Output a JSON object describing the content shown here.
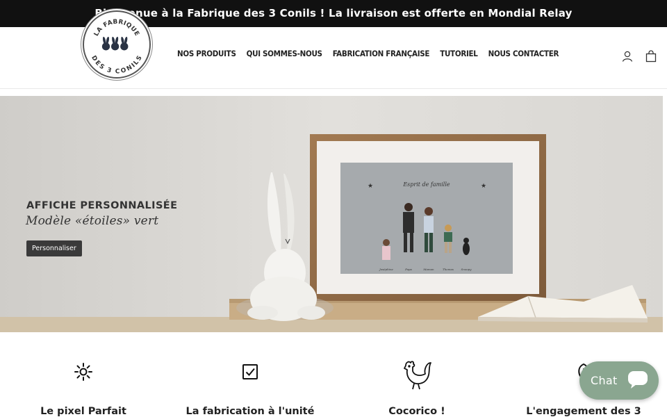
{
  "announcement": {
    "text": "Bienvenue à la Fabrique des 3 Conils ! La livraison est offerte en Mondial Relay"
  },
  "logo": {
    "top_text": "LA FABRIQUE",
    "bottom_text": "DES 3 CONILS"
  },
  "nav": {
    "items": [
      {
        "label": "NOS PRODUITS"
      },
      {
        "label": "QUI SOMMES-NOUS"
      },
      {
        "label": "FABRICATION FRANÇAISE"
      },
      {
        "label": "TUTORIEL"
      },
      {
        "label": "NOUS CONTACTER"
      }
    ]
  },
  "header_icons": {
    "account": "user-icon",
    "cart": "shopping-bag-icon"
  },
  "hero": {
    "title": "AFFICHE PERSONNALISÉE",
    "subtitle": "Modèle «étoiles» vert",
    "button": "Personnaliser",
    "poster_title": "Esprit de famille",
    "poster_names": [
      "Joséphine",
      "Papa",
      "Maman",
      "Thomas",
      "Snoopy"
    ]
  },
  "features": [
    {
      "icon": "sun-icon",
      "label": "Le pixel Parfait"
    },
    {
      "icon": "checkbox-icon",
      "label": "La fabrication à l'unité"
    },
    {
      "icon": "rooster-icon",
      "label": "Cocorico !"
    },
    {
      "icon": "leaf-icon",
      "label": "L'engagement des 3"
    }
  ],
  "chat": {
    "label": "Chat",
    "icon": "chat-bubble-icon"
  },
  "colors": {
    "announcement_bg": "#111111",
    "chat_bg": "#8aa690",
    "hero_button": "#3a3a3a"
  }
}
